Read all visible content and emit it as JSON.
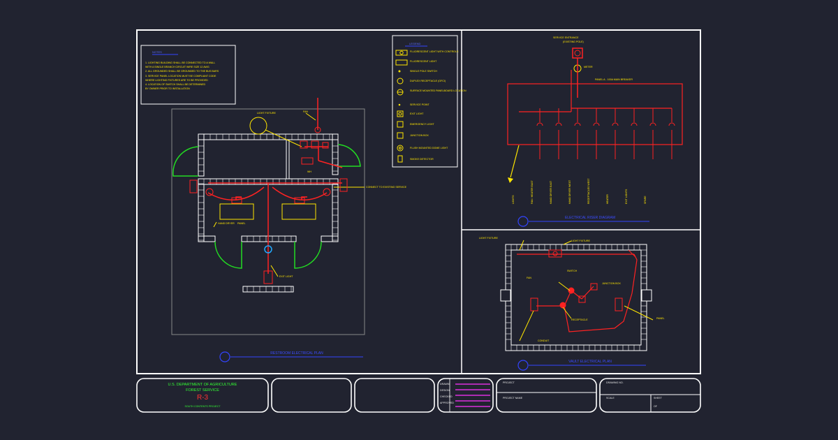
{
  "title_block": {
    "agency_line1": "U.S. DEPARTMENT OF AGRICULTURE",
    "agency_line2": "FOREST SERVICE",
    "region": "R-3",
    "project_line": "SOUTH CONTENTS PROJECT",
    "field_labels": [
      "DRAWN",
      "DESIGN",
      "CHECKED",
      "APPROVED"
    ],
    "project_label": "PROJECT",
    "title_label": "PROJECT NAME",
    "drawing_label": "DRAWING NO.",
    "scale_label": "SCALE",
    "sheet_label": "SHEET",
    "sheet_value": "OF"
  },
  "notes": {
    "title": "NOTES",
    "lines": [
      "1. LIGHTING BUILDING SHALL BE CONNECTED TO A WALL",
      "   WITH A SINGLE BRANCH CIRCUIT       WIRE SIZE 12 AWG",
      "2. ALL GROUNDED SHALL BE GROUNDED TO THE BUS BARS",
      "3. SERVICE PANEL LOCATION MUST BE COMPLIANT CODE",
      "   WHERE LIGHTING FIXTURES ARE TO BE PROVIDED",
      "4. LOCATION OF SWITCH SHALL BE DETERMINED",
      "   BY OWNER PRIOR TO INSTALLATION"
    ]
  },
  "legend": {
    "title": "LEGEND",
    "items": [
      "FLUORESCENT LIGHT WITH CONTROLS",
      "FLUORESCENT LIGHT",
      "SINGLE POLE SWITCH",
      "DUPLEX RECEPTACLE (GFCI)",
      "SURFACE MOUNTED PANELBOARD LOCATION",
      "SERVICE POINT",
      "EXIT LIGHT",
      "EMERGENCY LIGHT",
      "JUNCTION BOX",
      "FLUSH MOUNTED DOME LIGHT",
      "SMOKE DETECTOR"
    ]
  },
  "floor_plan": {
    "title": "RESTROOM ELECTRICAL PLAN",
    "labels": [
      "LIGHT FIXTURE",
      "EXIT LIGHT",
      "HAND DRYER",
      "PANEL",
      "CONNECT TO EXISTING SERVICE",
      "FAN",
      "WH"
    ]
  },
  "riser": {
    "title": "ELECTRICAL RISER DIAGRAM",
    "top_label": "SERVICE ENTRANCE",
    "top_sub": "(EXISTING POLE)",
    "panel_label": "PANEL A - 100A MAIN BREAKER",
    "meter_label": "METER",
    "circuit_labels": [
      "LIGHTS",
      "FAN / HEATER EAST",
      "HAND DRYER EAST",
      "HAND DRYER WEST",
      "RECEPTACLES WEST",
      "HEATER",
      "EXIT LIGHTS",
      "SPARE"
    ]
  },
  "vault_plan": {
    "title": "VAULT ELECTRICAL PLAN",
    "labels": [
      "LIGHT FIXTURE",
      "SWITCH",
      "FAN",
      "JUNCTION BOX",
      "RECEPTACLE",
      "PANEL",
      "CONDUIT"
    ]
  },
  "colors": {
    "background": "#212330",
    "frame": "#ffffff",
    "wall": "#ffffff",
    "wire": "#ff2222",
    "label": "#ffe600",
    "door": "#22dd22",
    "title": "#3344ff",
    "magenta": "#ff33ff"
  }
}
